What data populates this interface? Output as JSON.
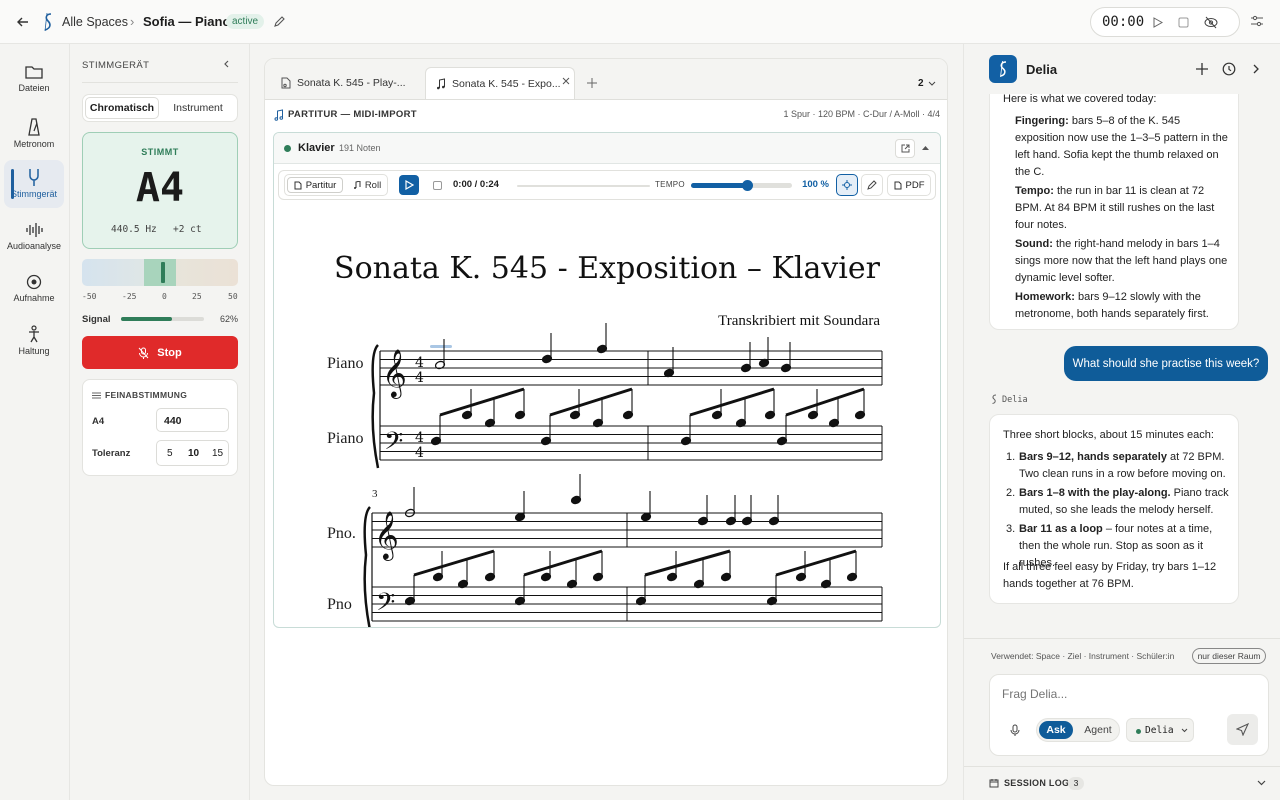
{
  "topbar": {
    "back_label": "Alle Spaces",
    "separator": "›",
    "title": "Sofia — Piano",
    "status": "active",
    "timer": "00:00"
  },
  "rail": [
    {
      "label": "Dateien",
      "icon": "folder-icon"
    },
    {
      "label": "Metronom",
      "icon": "metronome-icon"
    },
    {
      "label": "Stimmgerät",
      "icon": "tuning-fork-icon"
    },
    {
      "label": "Audioanalyse",
      "icon": "waveform-icon"
    },
    {
      "label": "Aufnahme",
      "icon": "record-icon"
    },
    {
      "label": "Haltung",
      "icon": "posture-icon"
    }
  ],
  "tuner": {
    "header": "STIMMGERÄT",
    "modes": [
      "Chromatisch",
      "Instrument"
    ],
    "status": "STIMMT",
    "note": "A4",
    "freq": "440.5 Hz",
    "cents": "+2 ct",
    "scale": [
      "-50",
      "-25",
      "0",
      "25",
      "50"
    ],
    "meter_cents": 2,
    "signal_label": "Signal",
    "signal_pct": "62%",
    "signal_fraction": 0.62,
    "stop_label": "Stop",
    "fine_header": "FEINABSTIMMUNG",
    "a4_label": "A4",
    "a4_value": "440",
    "tol_label": "Toleranz",
    "tol_options": [
      "5",
      "10",
      "15"
    ]
  },
  "doc": {
    "tabs": [
      "Sonata K. 545 - Play-...",
      "Sonata K. 545 - Expo..."
    ],
    "tab_count": "2",
    "header_label": "PARTITUR — MIDI-IMPORT",
    "header_meta": "1 Spur · 120 BPM · C-Dur / A-Moll · 4/4",
    "track_name": "Klavier",
    "track_notes": "191 Noten",
    "view_modes": [
      "Partitur",
      "Roll"
    ],
    "time": "0:00 / 0:24",
    "tempo_label": "TEMPO",
    "tempo_value": "100 %",
    "tempo_fraction": 0.56,
    "pdf_label": "PDF",
    "score_title": "Sonata K. 545 - Exposition – Klavier",
    "score_subtitle": "Transkribiert mit Soundara",
    "staff_labels": [
      "Piano",
      "Piano",
      "Pno.",
      "Pno"
    ],
    "measure_number": "3"
  },
  "chat": {
    "name": "Delia",
    "intro": "Here is what we covered today:",
    "summary": [
      {
        "head": "Fingering:",
        "text": " bars 5–8 of the K. 545 exposition now use the 1–3–5 pattern in the left hand. Sofia kept the thumb relaxed on the C."
      },
      {
        "head": "Tempo:",
        "text": " the run in bar 11 is clean at 72 BPM. At 84 BPM it still rushes on the last four notes."
      },
      {
        "head": "Sound:",
        "text": " the right-hand melody in bars 1–4 sings more now that the left hand plays one dynamic level softer."
      },
      {
        "head": "Homework:",
        "text": " bars 9–12 slowly with the metronome, both hands separately first."
      }
    ],
    "user_message": "What should she practise this week?",
    "assistant_label": "Delia",
    "reply_intro": "Three short blocks, about 15 minutes each:",
    "reply_items": [
      {
        "head": "Bars 9–12, hands separately",
        "text": " at 72 BPM. Two clean runs in a row before moving on."
      },
      {
        "head": "Bars 1–8 with the play-along.",
        "text": " Piano track muted, so she leads the melody herself."
      },
      {
        "head": "Bar 11 as a loop",
        "text": " – four notes at a time, then the whole run. Stop as soon as it rushes."
      }
    ],
    "reply_outro": "If all three feel easy by Friday, try bars 1–12 hands together at 76 BPM.",
    "context": "Verwendet: Space · Ziel · Instrument · Schüler:in",
    "scope_label": "nur dieser Raum",
    "placeholder": "Frag Delia...",
    "mode_ask": "Ask",
    "mode_agent": "Agent",
    "model": "Delia",
    "log_label": "SESSION LOG",
    "log_count": "3"
  },
  "colors": {
    "accent": "#0f5c99",
    "green": "#2f7d59",
    "stop": "#e02a2a"
  }
}
